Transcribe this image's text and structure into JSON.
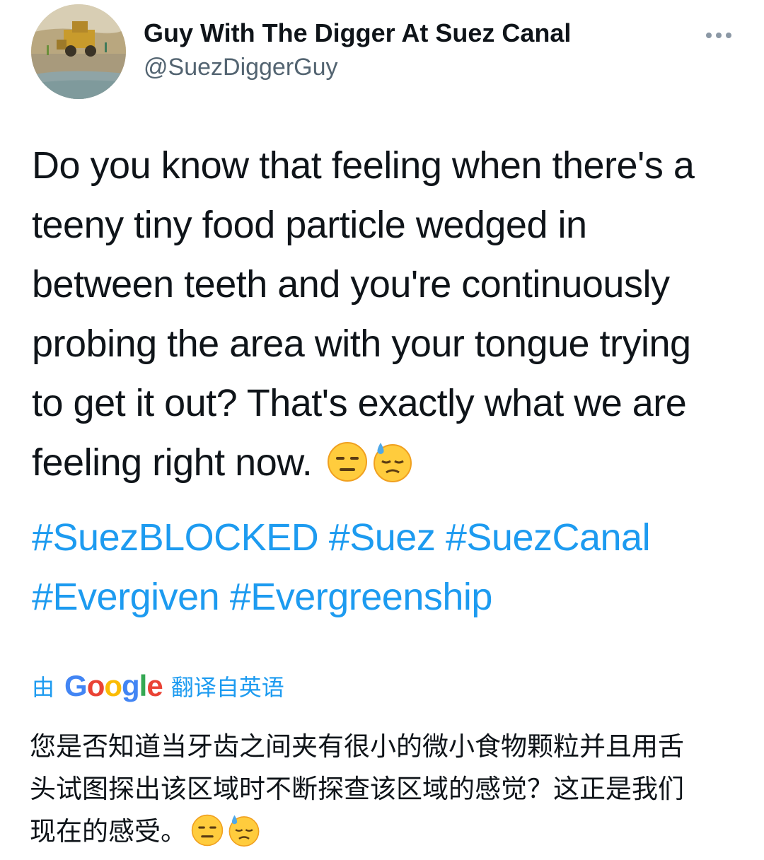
{
  "author": {
    "display_name": "Guy With The Digger At Suez Canal",
    "handle": "@SuezDiggerGuy"
  },
  "tweet": {
    "lines": [
      "Do you know that feeling when there's a",
      "teeny tiny food particle wedged in",
      "between teeth and you're continuously",
      "probing the area with your tongue trying",
      "to get it out? That's exactly what we are",
      "feeling right now."
    ],
    "emojis": [
      "expressionless-face",
      "downcast-face-with-sweat"
    ]
  },
  "hashtags": [
    "#SuezBLOCKED",
    "#Suez",
    "#SuezCanal",
    "#Evergiven",
    "#Evergreenship"
  ],
  "translation": {
    "prefix": "由",
    "provider": "Google",
    "suffix": "翻译自英语",
    "lines": [
      "您是否知道当牙齿之间夹有很小的微小食物颗粒并且用舌",
      "头试图探出该区域时不断探查该区域的感觉？这正是我们",
      "现在的感受。"
    ]
  },
  "colors": {
    "link": "#1d9bf0",
    "text": "#0f1419",
    "secondary": "#536471"
  }
}
